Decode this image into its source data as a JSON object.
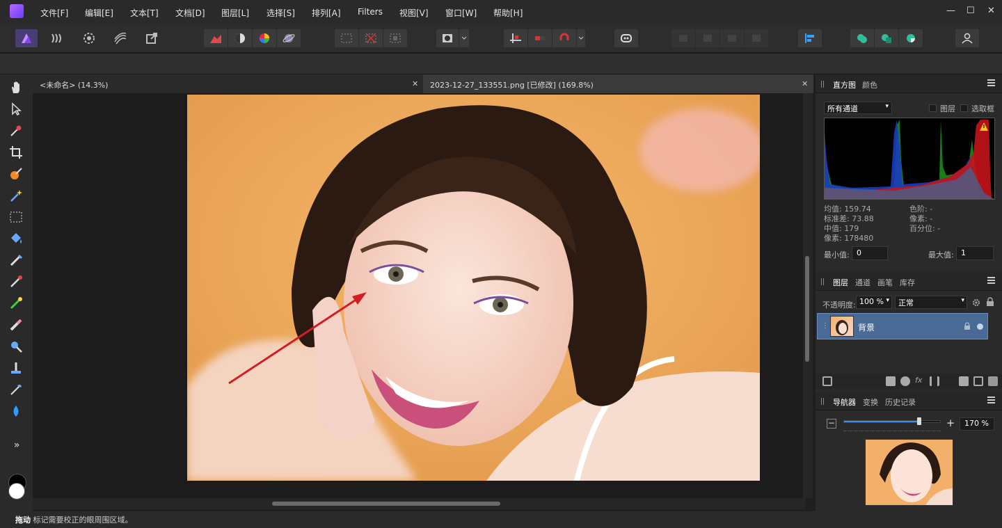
{
  "menu": {
    "items": [
      "文件[F]",
      "编辑[E]",
      "文本[T]",
      "文档[D]",
      "图层[L]",
      "选择[S]",
      "排列[A]",
      "Filters",
      "视图[V]",
      "窗口[W]",
      "帮助[H]"
    ]
  },
  "window_controls": {
    "minimize": "—",
    "maximize": "☐",
    "close": "✕"
  },
  "toolbar": {
    "personas": [
      "photo-persona-icon",
      "liquify-persona-icon",
      "develop-persona-icon",
      "tone-mapping-persona-icon",
      "export-persona-icon"
    ],
    "accent": "#6a3cff"
  },
  "tools": [
    "hand-tool-icon",
    "move-tool-icon",
    "color-picker-icon",
    "crop-tool-icon",
    "selection-brush-icon",
    "flood-select-icon",
    "marquee-tool-icon",
    "flood-fill-icon",
    "paint-brush-icon",
    "pixel-tool-icon",
    "paint-mixer-icon",
    "erase-brush-icon",
    "dodge-brush-icon",
    "clone-brush-icon",
    "smudge-brush-icon",
    "blur-brush-icon",
    "more-tools-icon"
  ],
  "doc_tabs": [
    {
      "label": "<未命名> (14.3%)",
      "close": "✕"
    },
    {
      "label": "2023-12-27_133551.png [已修改] (169.8%)",
      "close": "✕"
    }
  ],
  "status": {
    "action": "拖动",
    "message": "标记需要校正的眼周围区域。"
  },
  "histogram_panel": {
    "tabs": [
      "直方图",
      "颜色"
    ],
    "channel": "所有通道",
    "layer_check": "图层",
    "marquee_check": "选取框",
    "stats_left": [
      "均值: 159.74",
      "标准差: 73.88",
      "中值: 179",
      "像素: 178480"
    ],
    "stats_right": [
      "色阶: -",
      "像素: -",
      "百分位: -"
    ],
    "min_label": "最小值:",
    "min_value": "0",
    "max_label": "最大值:",
    "max_value": "1"
  },
  "layers_panel": {
    "tabs": [
      "图层",
      "通道",
      "画笔",
      "库存"
    ],
    "opacity_label": "不透明度:",
    "opacity_value": "100 %",
    "blend_mode": "正常",
    "layer_name": "背景"
  },
  "navigator_panel": {
    "tabs": [
      "导航器",
      "变换",
      "历史记录"
    ],
    "zoom_value": "170 %",
    "zoom_level": 0.78
  }
}
